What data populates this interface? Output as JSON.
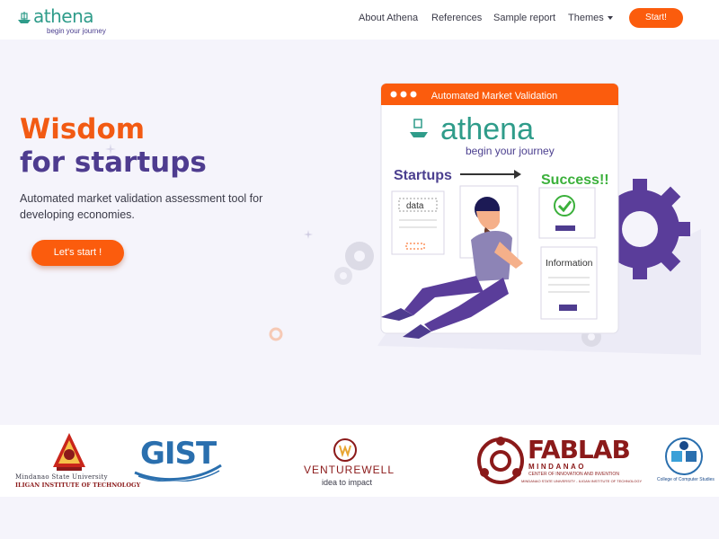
{
  "header": {
    "logo_word": "athena",
    "logo_tagline": "begin your journey",
    "nav": [
      {
        "label": "About Athena"
      },
      {
        "label": "References"
      },
      {
        "label": "Sample report"
      },
      {
        "label": "Themes"
      }
    ],
    "start_label": "Start!"
  },
  "hero": {
    "title_line1": "Wisdom",
    "title_line2": "for startups",
    "subtitle": "Automated market validation assessment tool for developing economies.",
    "cta_label": "Let's start !"
  },
  "illustration": {
    "window_title": "Automated Market Validation",
    "brand": "athena",
    "brand_tagline": "begin your journey",
    "startups_label": "Startups",
    "success_label": "Success!!",
    "data_label": "data",
    "information_label": "Information"
  },
  "partners": {
    "msu_name": "Mindanao State University",
    "msu_institute": "ILIGAN INSTITUTE OF TECHNOLOGY",
    "gist": "GIST",
    "venturewell": "VENTUREWELL",
    "venturewell_tag": "idea to impact",
    "fablab": "FABLAB",
    "fablab_sub": "MINDANAO",
    "fablab_center": "CENTER OF INNOVATION AND INVENTION",
    "fablab_uni": "MINDANAO STATE UNIVERSITY - ILIGAN INSTITUTE OF TECHNOLOGY",
    "ccs": "College of Computer Studies"
  },
  "colors": {
    "accent_orange": "#fb5c0d",
    "brand_purple": "#4e3c8f",
    "brand_teal": "#2f9c8a"
  }
}
